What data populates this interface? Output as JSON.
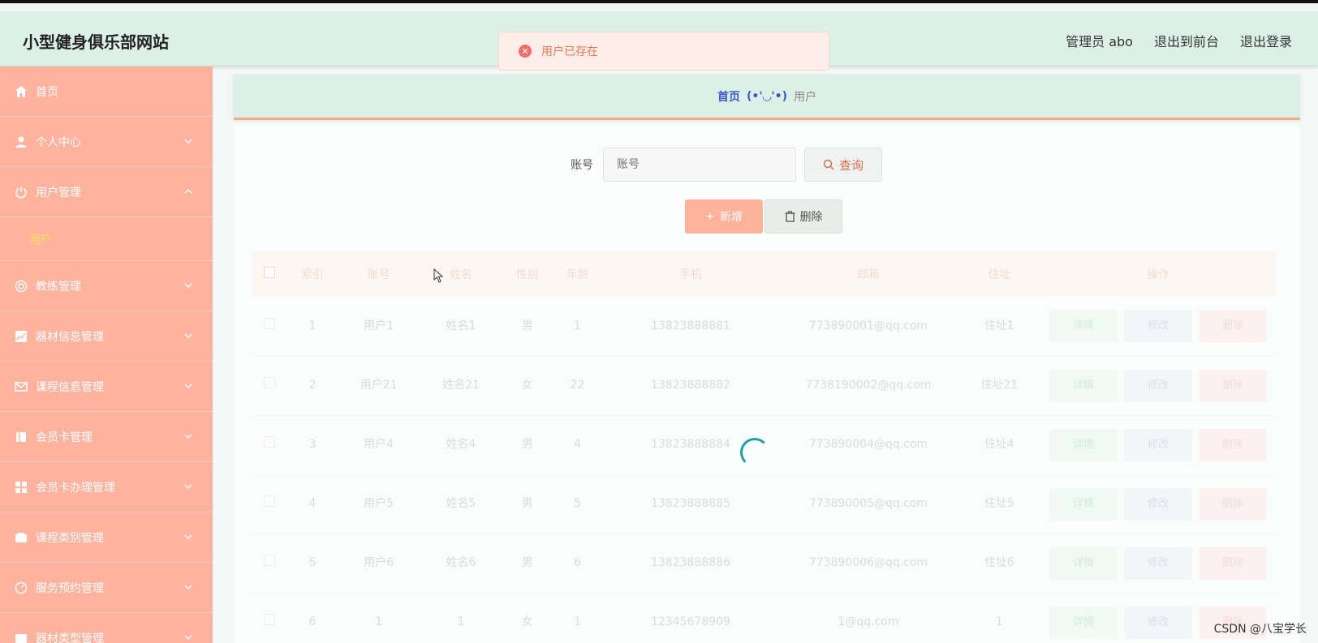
{
  "header": {
    "site_title": "小型健身俱乐部网站",
    "admin_label": "管理员 abo",
    "to_frontend": "退出到前台",
    "logout": "退出登录"
  },
  "toast": {
    "message": "用户已存在",
    "icon": "error-circle-icon"
  },
  "sidebar": {
    "items": [
      {
        "label": "首页",
        "icon": "home-icon",
        "expandable": false
      },
      {
        "label": "个人中心",
        "icon": "user-icon",
        "expandable": true,
        "expanded": false
      },
      {
        "label": "用户管理",
        "icon": "power-icon",
        "expandable": true,
        "expanded": true
      },
      {
        "label": "教练管理",
        "icon": "lifebuoy-icon",
        "expandable": true,
        "expanded": false
      },
      {
        "label": "器材信息管理",
        "icon": "chart-icon",
        "expandable": true,
        "expanded": false
      },
      {
        "label": "课程信息管理",
        "icon": "mail-icon",
        "expandable": true,
        "expanded": false
      },
      {
        "label": "会员卡管理",
        "icon": "book-icon",
        "expandable": true,
        "expanded": false
      },
      {
        "label": "会员卡办理管理",
        "icon": "grid-icon",
        "expandable": true,
        "expanded": false
      },
      {
        "label": "课程类别管理",
        "icon": "wallet-icon",
        "expandable": true,
        "expanded": false
      },
      {
        "label": "服务预约管理",
        "icon": "gauge-icon",
        "expandable": true,
        "expanded": false
      },
      {
        "label": "器材类型管理",
        "icon": "box-icon",
        "expandable": true,
        "expanded": false
      }
    ],
    "subitem": "用户"
  },
  "breadcrumb": {
    "home": "首页",
    "separator": "(•'◡'•)",
    "current": "用户"
  },
  "search": {
    "label": "账号",
    "placeholder": "账号",
    "button": "查询"
  },
  "actions": {
    "add": "新增",
    "delete": "删除"
  },
  "table": {
    "columns": [
      "索引",
      "账号",
      "姓名",
      "性别",
      "年龄",
      "手机",
      "邮箱",
      "住址",
      "操作"
    ],
    "rows": [
      [
        "1",
        "用户1",
        "姓名1",
        "男",
        "1",
        "13823888881",
        "773890001@qq.com",
        "住址1"
      ],
      [
        "2",
        "用户21",
        "姓名21",
        "女",
        "22",
        "13823888882",
        "7738190002@qq.com",
        "住址21"
      ],
      [
        "3",
        "用户4",
        "姓名4",
        "男",
        "4",
        "13823888884",
        "773890004@qq.com",
        "住址4"
      ],
      [
        "4",
        "用户5",
        "姓名5",
        "男",
        "5",
        "13823888885",
        "773890005@qq.com",
        "住址5"
      ],
      [
        "5",
        "用户6",
        "姓名6",
        "男",
        "6",
        "13823888886",
        "773890006@qq.com",
        "住址6"
      ],
      [
        "6",
        "1",
        "1",
        "女",
        "1",
        "12345678909",
        "1@qq.com",
        "1"
      ]
    ],
    "ops": {
      "detail": "详情",
      "edit": "修改",
      "delete": "删除"
    }
  },
  "watermark": "CSDN @八宝学长"
}
